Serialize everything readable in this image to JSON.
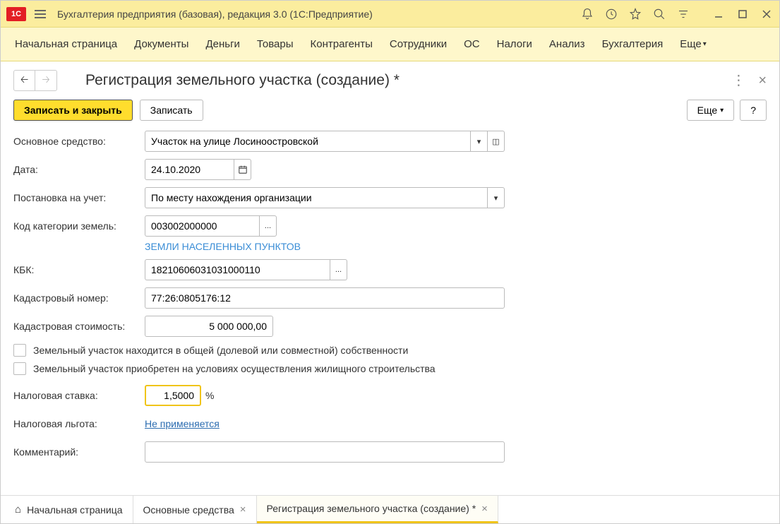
{
  "titlebar": {
    "app_title": "Бухгалтерия предприятия (базовая), редакция 3.0  (1С:Предприятие)",
    "logo": "1С"
  },
  "main_nav": {
    "items": [
      "Начальная страница",
      "Документы",
      "Деньги",
      "Товары",
      "Контрагенты",
      "Сотрудники",
      "ОС",
      "Налоги",
      "Анализ",
      "Бухгалтерия"
    ],
    "more": "Еще"
  },
  "page": {
    "title": "Регистрация земельного участка (создание) *"
  },
  "commands": {
    "save_close": "Записать и закрыть",
    "save": "Записать",
    "more": "Еще",
    "help": "?"
  },
  "form": {
    "asset_label": "Основное средство:",
    "asset_value": "Участок на улице Лосиноостровской",
    "date_label": "Дата:",
    "date_value": "24.10.2020",
    "registration_label": "Постановка на учет:",
    "registration_value": "По месту нахождения организации",
    "land_code_label": "Код категории земель:",
    "land_code_value": "003002000000",
    "land_code_hint": "ЗЕМЛИ НАСЕЛЕННЫХ ПУНКТОВ",
    "kbk_label": "КБК:",
    "kbk_value": "18210606031031000110",
    "cadastral_num_label": "Кадастровый номер:",
    "cadastral_num_value": "77:26:0805176:12",
    "cadastral_cost_label": "Кадастровая стоимость:",
    "cadastral_cost_value": "5 000 000,00",
    "check_shared": "Земельный участок находится в общей (долевой или совместной) собственности",
    "check_housing": "Земельный участок приобретен на условиях осуществления жилищного строительства",
    "tax_rate_label": "Налоговая ставка:",
    "tax_rate_value": "1,5000",
    "tax_rate_unit": "%",
    "tax_benefit_label": "Налоговая льгота:",
    "tax_benefit_value": "Не применяется",
    "comment_label": "Комментарий:",
    "comment_value": ""
  },
  "footer_tabs": {
    "home": "Начальная страница",
    "tab1": "Основные средства",
    "tab2": "Регистрация земельного участка (создание) *"
  }
}
